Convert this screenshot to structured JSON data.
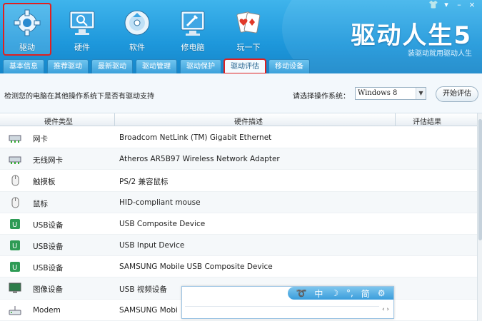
{
  "header": {
    "brand": "驱动人生5",
    "slogan": "装驱动就用驱动人生",
    "nav": [
      {
        "label": "驱动",
        "icon": "gear-icon"
      },
      {
        "label": "硬件",
        "icon": "monitor-icon"
      },
      {
        "label": "软件",
        "icon": "disc-icon"
      },
      {
        "label": "修电脑",
        "icon": "toolbox-icon"
      },
      {
        "label": "玩一下",
        "icon": "cards-icon"
      }
    ]
  },
  "tabs": [
    "基本信息",
    "推荐驱动",
    "最新驱动",
    "驱动管理",
    "驱动保护",
    "驱动评估",
    "移动设备"
  ],
  "toolbar": {
    "description": "检测您的电脑在其他操作系统下是否有驱动支持",
    "os_label": "请选择操作系统：",
    "os_value": "Windows 8",
    "start_button": "开始评估"
  },
  "table": {
    "headers": [
      "硬件类型",
      "硬件描述",
      "评估结果"
    ],
    "rows": [
      {
        "type": "网卡",
        "desc": "Broadcom NetLink (TM) Gigabit Ethernet",
        "icon": "network-card-icon"
      },
      {
        "type": "无线网卡",
        "desc": "Atheros AR5B97 Wireless Network Adapter",
        "icon": "network-card-icon"
      },
      {
        "type": "触摸板",
        "desc": "PS/2 兼容鼠标",
        "icon": "mouse-icon"
      },
      {
        "type": "鼠标",
        "desc": "HID-compliant mouse",
        "icon": "mouse-icon"
      },
      {
        "type": "USB设备",
        "desc": "USB Composite Device",
        "icon": "usb-icon"
      },
      {
        "type": "USB设备",
        "desc": "USB Input Device",
        "icon": "usb-icon"
      },
      {
        "type": "USB设备",
        "desc": "SAMSUNG Mobile USB Composite Device",
        "icon": "usb-icon"
      },
      {
        "type": "图像设备",
        "desc": "USB 视频设备",
        "icon": "display-icon"
      },
      {
        "type": "Modem",
        "desc": "SAMSUNG Mobi",
        "icon": "modem-icon"
      }
    ]
  },
  "ime": {
    "items": [
      "中",
      "简"
    ],
    "nav": "‹ ›"
  }
}
